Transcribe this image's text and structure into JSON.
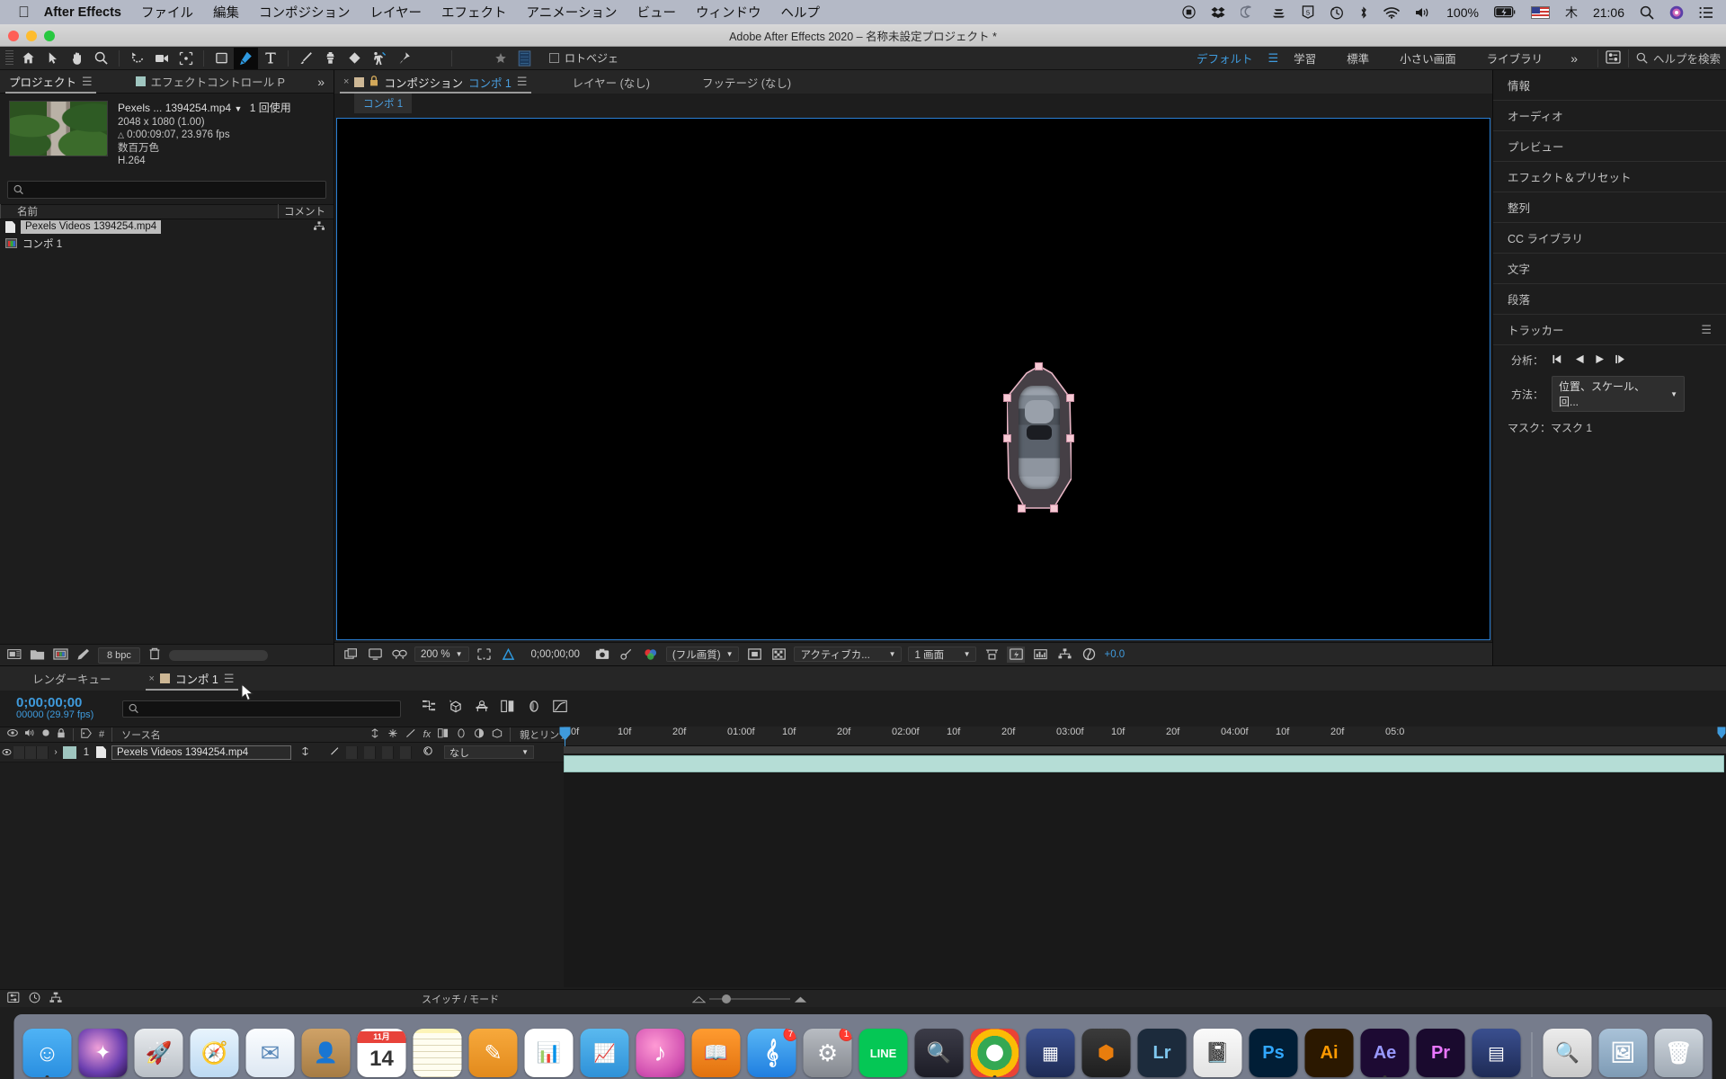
{
  "mac_menu": {
    "app_name": "After Effects",
    "items": [
      "ファイル",
      "編集",
      "コンポジション",
      "レイヤー",
      "エフェクト",
      "アニメーション",
      "ビュー",
      "ウィンドウ",
      "ヘルプ"
    ],
    "battery": "100%",
    "day": "木",
    "time": "21:06",
    "status_icons": [
      "record-icon",
      "dropbox-icon",
      "creative-cloud-icon",
      "backup-icon",
      "html5-icon",
      "time-machine-icon",
      "bluetooth-icon",
      "wifi-icon",
      "volume-icon",
      "battery-icon",
      "input-flag-icon",
      "spotlight-icon",
      "notification-center-icon"
    ]
  },
  "window": {
    "title": "Adobe After Effects 2020 – 名称未設定プロジェクト *"
  },
  "toolbar": {
    "tools": [
      {
        "name": "home-icon",
        "label": "ホーム"
      },
      {
        "name": "selection-tool-icon",
        "label": "選択ツール"
      },
      {
        "name": "hand-tool-icon",
        "label": "手のひらツール"
      },
      {
        "name": "zoom-tool-icon",
        "label": "ズームツール"
      },
      {
        "name": "rotation-tool-icon",
        "label": "回転ツール"
      },
      {
        "name": "camera-tool-icon",
        "label": "カメラツール"
      },
      {
        "name": "anchor-point-tool-icon",
        "label": "アンカーポイントツール"
      },
      {
        "name": "shape-tool-icon",
        "label": "シェイプツール"
      },
      {
        "name": "pen-tool-icon",
        "label": "ペンツール"
      },
      {
        "name": "type-tool-icon",
        "label": "文字ツール"
      },
      {
        "name": "brush-tool-icon",
        "label": "ブラシツール"
      },
      {
        "name": "clone-stamp-tool-icon",
        "label": "コピースタンプツール"
      },
      {
        "name": "eraser-tool-icon",
        "label": "消しゴムツール"
      },
      {
        "name": "roto-brush-tool-icon",
        "label": "ロトブラシツール"
      },
      {
        "name": "puppet-pin-tool-icon",
        "label": "パペットピンツール"
      }
    ],
    "roto_star_icon": "star-icon",
    "roto_swatch_icon": "roto-swatch-icon",
    "roto_checkbox_label": "ロトベジェ"
  },
  "workspaces": {
    "items": [
      "デフォルト",
      "学習",
      "標準",
      "小さい画面",
      "ライブラリ"
    ],
    "active": "デフォルト",
    "overflow_icon": "chevron-double-right-icon",
    "layout_icon": "workspace-settings-icon",
    "help_placeholder": "ヘルプを検索"
  },
  "project_panel": {
    "tabs": [
      {
        "label": "プロジェクト",
        "active": true,
        "icon": "panel-menu-icon"
      },
      {
        "label": "エフェクトコントロール P",
        "active": false,
        "icon": "effect-controls-swatch"
      }
    ],
    "overflow_icon": "chevron-double-right-icon",
    "selected_item": {
      "name": "Pexels ... 1394254.mp4",
      "usage": "1 回使用",
      "resolution": "2048 x 1080 (1.00)",
      "duration": "0:00:09:07, 23.976 fps",
      "color_depth": "数百万色",
      "codec": "H.264"
    },
    "search_placeholder": "",
    "columns": [
      "名前",
      "コメント"
    ],
    "rows": [
      {
        "name": "Pexels Videos 1394254.mp4",
        "icon": "footage-file-icon",
        "selected": true,
        "link_icon": "set-proxy-icon"
      },
      {
        "name": "コンポ 1",
        "icon": "composition-icon",
        "selected": false,
        "link_icon": ""
      }
    ],
    "footer": {
      "bit_depth": "8 bpc",
      "icons": [
        "interpret-footage-icon",
        "new-folder-icon",
        "new-composition-icon",
        "project-settings-icon",
        "delete-icon"
      ]
    }
  },
  "comp_panel": {
    "tabs": [
      {
        "close": "×",
        "swatch": "comp-swatch",
        "lock_icon": "lock-icon",
        "prefix": "コンポジション",
        "name": "コンポ 1",
        "menu_icon": "panel-menu-icon",
        "active": true
      },
      {
        "label": "レイヤー (なし)",
        "active": false
      },
      {
        "label": "フッテージ (なし)",
        "active": false
      }
    ],
    "breadcrumb_chip": "コンポ 1",
    "bottom_bar": {
      "magnification": "200 %",
      "timecode": "0;00;00;00",
      "quality": "(フル画質)",
      "view_layout": "アクティブカ...",
      "views": "1 画面",
      "exposure": "+0.0",
      "icons": [
        "always-preview-icon",
        "toggle-viewer-icon",
        "3d-glasses-icon",
        "region-of-interest-icon",
        "transparency-grid-icon",
        "snapshot-icon",
        "show-snapshot-icon",
        "channel-rgb-icon",
        "toggle-mask-icon",
        "toggle-alpha-icon",
        "timeline-icon",
        "fast-previews-icon",
        "graph-icon",
        "renderer-icon",
        "exposure-icon"
      ]
    },
    "tracker_overlay": {
      "mask_name": "マスク 1",
      "handle_color": "#f6c9d4",
      "outline_color": "#e8b6c5"
    }
  },
  "right_dock": {
    "panels": [
      {
        "label": "情報"
      },
      {
        "label": "オーディオ"
      },
      {
        "label": "プレビュー"
      },
      {
        "label": "エフェクト＆プリセット"
      },
      {
        "label": "整列"
      },
      {
        "label": "CC ライブラリ"
      },
      {
        "label": "文字"
      },
      {
        "label": "段落"
      }
    ],
    "tracker": {
      "title": "トラッカー",
      "menu_icon": "panel-menu-icon",
      "analyze_label": "分析：",
      "analyze_buttons": [
        "analyze-1-backward-icon",
        "analyze-backward-icon",
        "analyze-forward-icon",
        "analyze-1-forward-icon"
      ],
      "method_label": "方法：",
      "method_value": "位置、スケール、回...",
      "mask_label": "マスク：マスク 1"
    }
  },
  "timeline": {
    "tabs": [
      {
        "label": "レンダーキュー",
        "active": false
      },
      {
        "close": "×",
        "swatch": "comp-swatch",
        "label": "コンポ 1",
        "menu_icon": "panel-menu-icon",
        "active": true
      }
    ],
    "current_time": "0;00;00;00",
    "frame_info": "00000 (29.97 fps)",
    "search_placeholder": "",
    "toolbar_icons": [
      "composition-mini-flowchart-icon",
      "draft-3d-icon",
      "hide-shy-layers-icon",
      "frame-blending-icon",
      "motion-blur-icon",
      "graph-editor-icon"
    ],
    "columns": {
      "toggles": [
        "video-icon",
        "audio-icon",
        "solo-icon",
        "lock-icon"
      ],
      "label_icon": "label-icon",
      "index": "#",
      "source_name": "ソース名",
      "switches": [
        "shy-icon",
        "collapse-icon",
        "quality-icon",
        "fx-icon",
        "frame-blend-icon",
        "motion-blur-icon",
        "adjustment-icon",
        "3d-layer-icon"
      ],
      "parent": "親とリンク"
    },
    "layers": [
      {
        "index": "1",
        "name": "Pexels Videos 1394254.mp4",
        "parent": "なし",
        "label_color": "#9fc6c0",
        "clip_color": "#b5ddd6"
      }
    ],
    "ruler_ticks": [
      "0f",
      "10f",
      "20f",
      "01:00f",
      "10f",
      "20f",
      "02:00f",
      "10f",
      "20f",
      "03:00f",
      "10f",
      "20f",
      "04:00f",
      "10f",
      "20f",
      "05:0"
    ],
    "footer_label": "スイッチ / モード",
    "footer_icons": [
      "toggle-switches-modes-icon",
      "frame-render-time-icon",
      "comp-flowchart-icon"
    ]
  },
  "dock": {
    "items": [
      {
        "name": "finder",
        "bg": "#2a9bf0",
        "glyph": "☺",
        "badge": "",
        "running": true
      },
      {
        "name": "siri",
        "bg": "#141424",
        "glyph": "✦",
        "badge": "",
        "running": false
      },
      {
        "name": "launchpad",
        "bg": "#c4c9ce",
        "glyph": "🚀",
        "badge": "",
        "running": false
      },
      {
        "name": "safari",
        "bg": "#3d9fe0",
        "glyph": "🧭",
        "badge": "",
        "running": false
      },
      {
        "name": "mail",
        "bg": "#e8eef6",
        "glyph": "✉",
        "badge": "",
        "running": false
      },
      {
        "name": "contacts",
        "bg": "#c49a5e",
        "glyph": "👥",
        "badge": "",
        "running": false
      },
      {
        "name": "calendar",
        "bg": "#ffffff",
        "glyph": "14",
        "badge": "",
        "running": false
      },
      {
        "name": "notes",
        "bg": "#fdf0a8",
        "glyph": "📝",
        "badge": "",
        "running": false
      },
      {
        "name": "pages",
        "bg": "#f0a33c",
        "glyph": "✎",
        "badge": "",
        "running": false
      },
      {
        "name": "numbers",
        "bg": "#ffffff",
        "glyph": "📊",
        "badge": "",
        "running": false
      },
      {
        "name": "keynote",
        "bg": "#3aa4e0",
        "glyph": "📈",
        "badge": "",
        "running": false
      },
      {
        "name": "itunes",
        "bg": "#e05fb4",
        "glyph": "♪",
        "badge": "",
        "running": false
      },
      {
        "name": "ibooks",
        "bg": "#f08a20",
        "glyph": "📖",
        "badge": "",
        "running": false
      },
      {
        "name": "app-store",
        "bg": "#2a8ef0",
        "glyph": "A",
        "badge": "7",
        "running": false
      },
      {
        "name": "system-preferences",
        "bg": "#8e8e93",
        "glyph": "⚙",
        "badge": "1",
        "running": false
      },
      {
        "name": "line",
        "bg": "#05c755",
        "glyph": "LINE",
        "badge": "",
        "running": false
      },
      {
        "name": "alfred",
        "bg": "#2b2b33",
        "glyph": "🎩",
        "badge": "",
        "running": false
      },
      {
        "name": "chrome",
        "bg": "#ffffff",
        "glyph": "◎",
        "badge": "",
        "running": true
      },
      {
        "name": "after-effects-media",
        "bg": "#2b3a6b",
        "glyph": "▦",
        "badge": "",
        "running": false
      },
      {
        "name": "blender",
        "bg": "#2a2a2a",
        "glyph": "⬢",
        "badge": "",
        "running": false
      },
      {
        "name": "lightroom",
        "bg": "#1c2b3c",
        "glyph": "Lr",
        "badge": "",
        "running": false
      },
      {
        "name": "notebook",
        "bg": "#f2f2f2",
        "glyph": "📓",
        "badge": "",
        "running": false
      },
      {
        "name": "photoshop",
        "bg": "#011e36",
        "glyph": "Ps",
        "badge": "",
        "running": false
      },
      {
        "name": "illustrator",
        "bg": "#2b1800",
        "glyph": "Ai",
        "badge": "",
        "running": false
      },
      {
        "name": "aftereffects",
        "bg": "#1d0a33",
        "glyph": "Ae",
        "badge": "",
        "running": true
      },
      {
        "name": "premiere",
        "bg": "#1a0a2e",
        "glyph": "Pr",
        "badge": "",
        "running": false
      },
      {
        "name": "media-encoder",
        "bg": "#2b3a6b",
        "glyph": "▤",
        "badge": "",
        "running": false
      },
      {
        "name": "preview-app",
        "bg": "#d8d8d8",
        "glyph": "🔍",
        "badge": "",
        "running": false
      },
      {
        "name": "downloads",
        "bg": "#9fb7cf",
        "glyph": "🖼",
        "badge": "",
        "running": false
      },
      {
        "name": "trash",
        "bg": "#b9c2cc",
        "glyph": "🗑",
        "badge": "",
        "running": false
      }
    ]
  }
}
